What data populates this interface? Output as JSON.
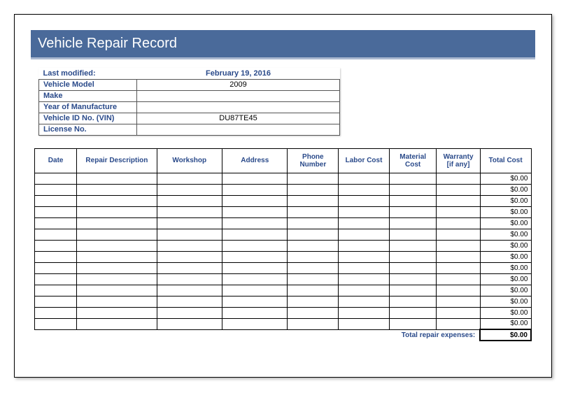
{
  "title": "Vehicle Repair Record",
  "meta": {
    "last_modified_label": "Last modified:",
    "last_modified_value": "February 19, 2016",
    "vehicle_model_label": "Vehicle Model",
    "vehicle_model_value": "2009",
    "make_label": "Make",
    "make_value": "",
    "year_label": "Year of Manufacture",
    "year_value": "",
    "vin_label": "Vehicle ID No. (VIN)",
    "vin_value": "DU87TE45",
    "license_label": "License No.",
    "license_value": ""
  },
  "columns": {
    "date": "Date",
    "desc": "Repair Description",
    "workshop": "Workshop",
    "address": "Address",
    "phone": "Phone Number",
    "labor": "Labor Cost",
    "material": "Material Cost",
    "warranty": "Warranty [if any]",
    "total": "Total Cost"
  },
  "rows": [
    {
      "date": "",
      "desc": "",
      "workshop": "",
      "address": "",
      "phone": "",
      "labor": "",
      "material": "",
      "warranty": "",
      "total": "$0.00"
    },
    {
      "date": "",
      "desc": "",
      "workshop": "",
      "address": "",
      "phone": "",
      "labor": "",
      "material": "",
      "warranty": "",
      "total": "$0.00"
    },
    {
      "date": "",
      "desc": "",
      "workshop": "",
      "address": "",
      "phone": "",
      "labor": "",
      "material": "",
      "warranty": "",
      "total": "$0.00"
    },
    {
      "date": "",
      "desc": "",
      "workshop": "",
      "address": "",
      "phone": "",
      "labor": "",
      "material": "",
      "warranty": "",
      "total": "$0.00"
    },
    {
      "date": "",
      "desc": "",
      "workshop": "",
      "address": "",
      "phone": "",
      "labor": "",
      "material": "",
      "warranty": "",
      "total": "$0.00"
    },
    {
      "date": "",
      "desc": "",
      "workshop": "",
      "address": "",
      "phone": "",
      "labor": "",
      "material": "",
      "warranty": "",
      "total": "$0.00"
    },
    {
      "date": "",
      "desc": "",
      "workshop": "",
      "address": "",
      "phone": "",
      "labor": "",
      "material": "",
      "warranty": "",
      "total": "$0.00"
    },
    {
      "date": "",
      "desc": "",
      "workshop": "",
      "address": "",
      "phone": "",
      "labor": "",
      "material": "",
      "warranty": "",
      "total": "$0.00"
    },
    {
      "date": "",
      "desc": "",
      "workshop": "",
      "address": "",
      "phone": "",
      "labor": "",
      "material": "",
      "warranty": "",
      "total": "$0.00"
    },
    {
      "date": "",
      "desc": "",
      "workshop": "",
      "address": "",
      "phone": "",
      "labor": "",
      "material": "",
      "warranty": "",
      "total": "$0.00"
    },
    {
      "date": "",
      "desc": "",
      "workshop": "",
      "address": "",
      "phone": "",
      "labor": "",
      "material": "",
      "warranty": "",
      "total": "$0.00"
    },
    {
      "date": "",
      "desc": "",
      "workshop": "",
      "address": "",
      "phone": "",
      "labor": "",
      "material": "",
      "warranty": "",
      "total": "$0.00"
    },
    {
      "date": "",
      "desc": "",
      "workshop": "",
      "address": "",
      "phone": "",
      "labor": "",
      "material": "",
      "warranty": "",
      "total": "$0.00"
    },
    {
      "date": "",
      "desc": "",
      "workshop": "",
      "address": "",
      "phone": "",
      "labor": "",
      "material": "",
      "warranty": "",
      "total": "$0.00"
    }
  ],
  "footer": {
    "label": "Total repair expenses:",
    "value": "$0.00"
  }
}
